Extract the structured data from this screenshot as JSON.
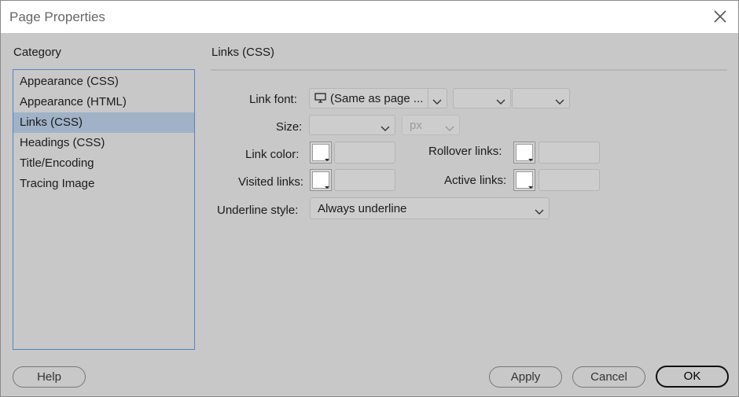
{
  "window": {
    "title": "Page Properties"
  },
  "category": {
    "heading": "Category",
    "items": [
      {
        "label": "Appearance (CSS)",
        "selected": false
      },
      {
        "label": "Appearance (HTML)",
        "selected": false
      },
      {
        "label": "Links (CSS)",
        "selected": true
      },
      {
        "label": "Headings (CSS)",
        "selected": false
      },
      {
        "label": "Title/Encoding",
        "selected": false
      },
      {
        "label": "Tracing Image",
        "selected": false
      }
    ]
  },
  "section": {
    "title": "Links (CSS)"
  },
  "form": {
    "link_font_label": "Link font:",
    "link_font_value": "(Same as page ...",
    "size_label": "Size:",
    "size_unit": "px",
    "link_color_label": "Link color:",
    "rollover_label": "Rollover links:",
    "visited_label": "Visited links:",
    "active_label": "Active links:",
    "underline_label": "Underline style:",
    "underline_value": "Always underline"
  },
  "buttons": {
    "help": "Help",
    "apply": "Apply",
    "cancel": "Cancel",
    "ok": "OK"
  },
  "colors": {
    "dialog_bg": "#c8c8c8",
    "selection": "#9fb2c8",
    "list_border": "#4f86c6"
  }
}
